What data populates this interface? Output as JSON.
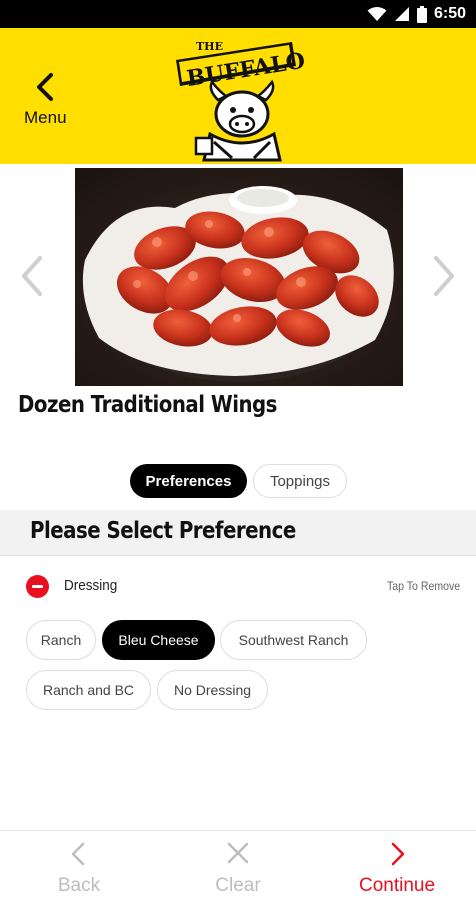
{
  "status_bar": {
    "time": "6:50"
  },
  "header": {
    "back_label": "Menu",
    "logo_text_top": "THE",
    "logo_text_main": "BUFFALO",
    "background_color": "#FFDE00"
  },
  "product": {
    "title": "Dozen Traditional Wings"
  },
  "tabs": [
    {
      "label": "Preferences",
      "active": true
    },
    {
      "label": "Toppings",
      "active": false
    }
  ],
  "section": {
    "title": "Please Select Preference",
    "item_label": "Dressing",
    "remove_hint": "Tap To Remove"
  },
  "options": [
    {
      "label": "Ranch",
      "selected": false
    },
    {
      "label": "Bleu Cheese",
      "selected": true
    },
    {
      "label": "Southwest Ranch",
      "selected": false
    },
    {
      "label": "Ranch and BC",
      "selected": false
    },
    {
      "label": "No Dressing",
      "selected": false
    }
  ],
  "bottom_bar": {
    "back_label": "Back",
    "clear_label": "Clear",
    "continue_label": "Continue"
  },
  "colors": {
    "accent_red": "#E8101E",
    "brand_yellow": "#FFDE00",
    "disabled_grey": "#bdbdbd"
  },
  "icons": {
    "status": [
      "wifi-icon",
      "signal-icon",
      "battery-icon"
    ],
    "header": [
      "chevron-left-icon"
    ],
    "carousel": [
      "chevron-left-icon",
      "chevron-right-icon"
    ],
    "section": [
      "remove-icon"
    ],
    "bottom_bar": [
      "chevron-left-icon",
      "close-icon",
      "chevron-right-icon"
    ]
  }
}
